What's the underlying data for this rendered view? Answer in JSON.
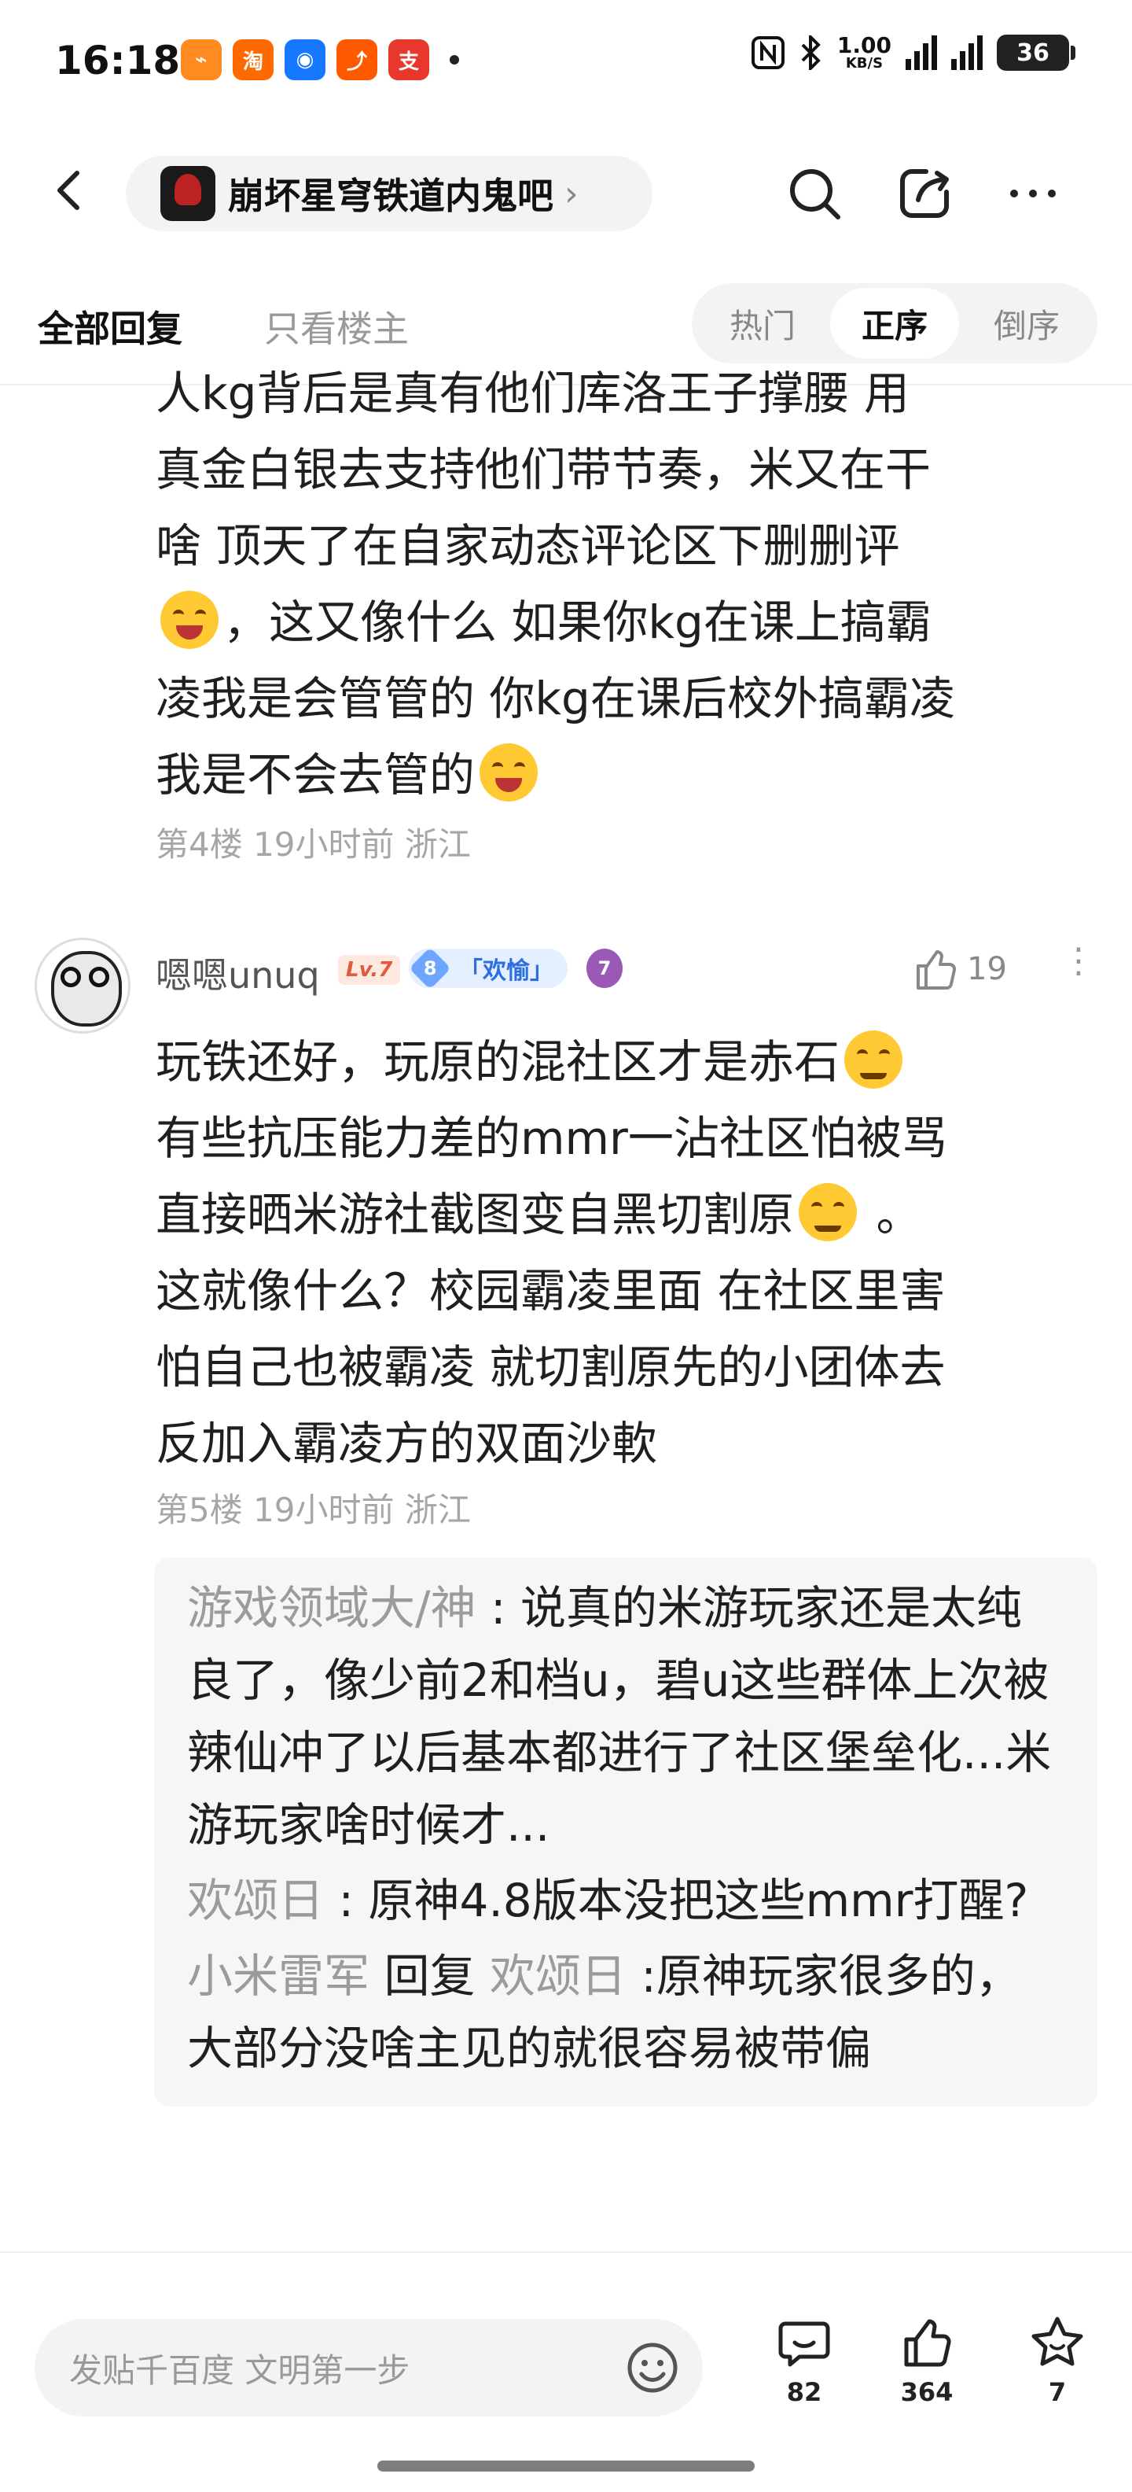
{
  "status": {
    "time": "16:18",
    "net_speed_value": "1.00",
    "net_speed_unit": "KB/S",
    "battery": "36",
    "app_icons": [
      "mango-icon",
      "taobao-icon",
      "chat-icon",
      "1688-icon",
      "alipay-icon"
    ]
  },
  "nav": {
    "forum_name": "崩坏星穹铁道内鬼吧"
  },
  "filter": {
    "tab_all": "全部回复",
    "tab_op": "只看楼主",
    "sort_hot": "热门",
    "sort_asc": "正序",
    "sort_desc": "倒序",
    "active_sort": "正序"
  },
  "post4": {
    "lines": [
      "人kg背后是真有他们库洛王子撑腰 用",
      "真金白银去支持他们带节奏，米又在干",
      "啥 顶天了在自家动态评论区下删删评",
      "，这又像什么 如果你kg在课上搞霸",
      "凌我是会管管的 你kg在课后校外搞霸凌",
      "我是不会去管的"
    ],
    "meta": "第4楼 19小时前 浙江"
  },
  "post5": {
    "username": "嗯嗯unuq",
    "level": "Lv.7",
    "badge_num": "8",
    "badge_label": "「欢愉」",
    "medal": "7",
    "likes": "19",
    "lines": [
      "玩铁还好，玩原的混社区才是赤石",
      "有些抗压能力差的mmr一沾社区怕被骂",
      "直接晒米游社截图变自黑切割原",
      "。",
      "这就像什么？校园霸凌里面 在社区里害",
      "怕自己也被霸凌 就切割原先的小团体去",
      "反加入霸凌方的双面沙軟"
    ],
    "meta": "第5楼 19小时前 浙江",
    "replies": [
      {
        "name": "游戏领域大/神",
        "sep": " : ",
        "text": "说真的米游玩家还是太纯良了，像少前2和档u，碧u这些群体上次被辣仙冲了以后基本都进行了社区堡垒化...米游玩家啥时候才..."
      },
      {
        "name": "欢颂日",
        "sep": " : ",
        "text": "原神4.8版本没把这些mmr打醒?"
      },
      {
        "name": "小米雷军",
        "reply_word": " 回复 ",
        "reply_to": "欢颂日",
        "sep": " :",
        "text": "原神玩家很多的，大部分没啥主见的就很容易被带偏"
      }
    ]
  },
  "bottom": {
    "placeholder": "发贴千百度 文明第一步",
    "comments": "82",
    "likes": "364",
    "favorites": "7"
  }
}
